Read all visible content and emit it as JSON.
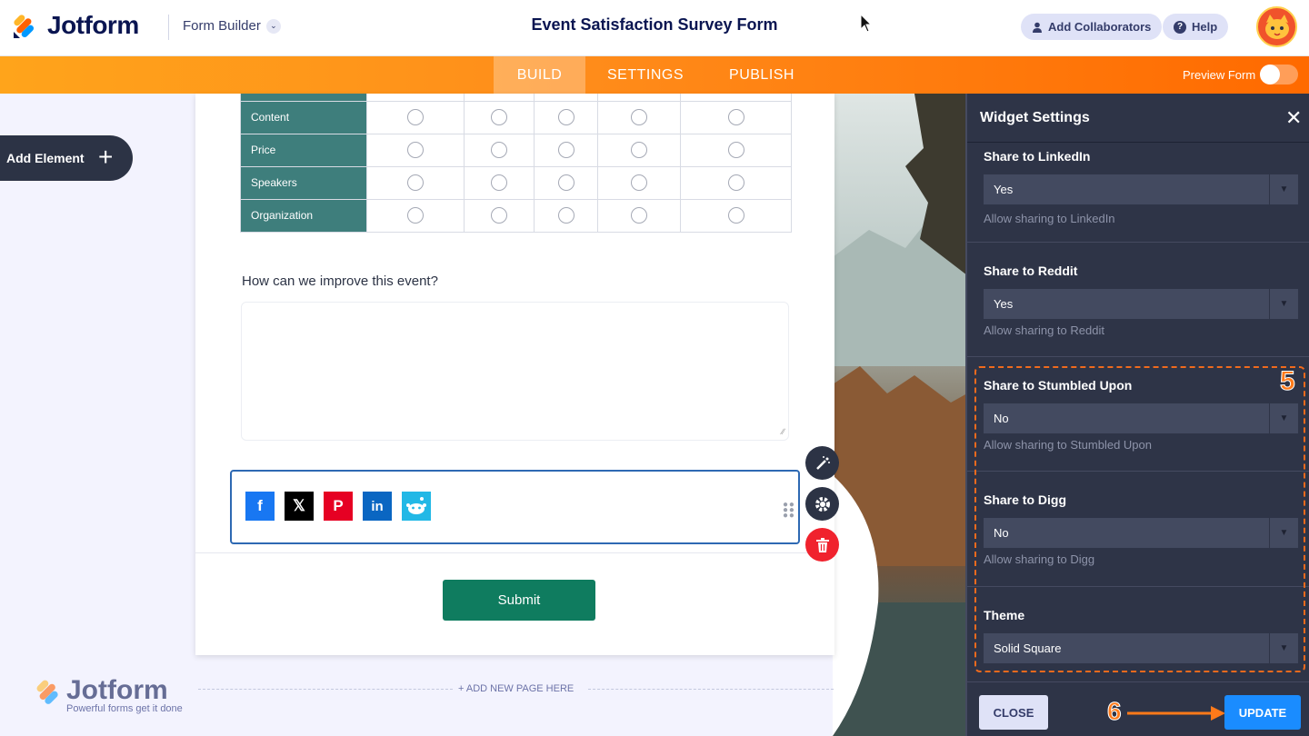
{
  "brand": {
    "name": "Jotform",
    "tagline": "Powerful forms get it done"
  },
  "header": {
    "builder_label": "Form Builder",
    "form_title": "Event Satisfaction Survey Form",
    "collab_label": "Add Collaborators",
    "help_label": "Help"
  },
  "nav": {
    "tabs": [
      "BUILD",
      "SETTINGS",
      "PUBLISH"
    ],
    "active": "BUILD",
    "preview_label": "Preview Form"
  },
  "left": {
    "add_element": "Add Element"
  },
  "form": {
    "matrix_rows": [
      "Content",
      "Price",
      "Speakers",
      "Organization"
    ],
    "question": "How can we improve this event?",
    "social_icons": [
      "facebook",
      "x",
      "pinterest",
      "linkedin",
      "reddit"
    ],
    "submit_label": "Submit",
    "add_page": "+ ADD NEW PAGE HERE"
  },
  "panel": {
    "title": "Widget Settings",
    "sections": [
      {
        "label": "Share to LinkedIn",
        "value": "Yes",
        "hint": "Allow sharing to LinkedIn"
      },
      {
        "label": "Share to Reddit",
        "value": "Yes",
        "hint": "Allow sharing to Reddit"
      },
      {
        "label": "Share to Stumbled Upon",
        "value": "No",
        "hint": "Allow sharing to Stumbled Upon"
      },
      {
        "label": "Share to Digg",
        "value": "No",
        "hint": "Allow sharing to Digg"
      },
      {
        "label": "Theme",
        "value": "Solid Square"
      }
    ],
    "close_label": "CLOSE",
    "update_label": "UPDATE"
  },
  "annotations": {
    "step5": "5",
    "step6": "6"
  },
  "colors": {
    "accent": "#ff6a00",
    "matrix_header": "#3e7e7c",
    "submit": "#0f7c5f",
    "update": "#1a8cff"
  }
}
